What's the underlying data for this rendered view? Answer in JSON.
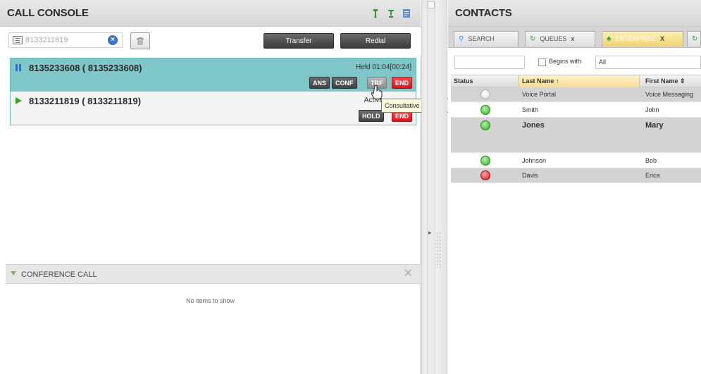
{
  "call_console": {
    "title": "CALL CONSOLE",
    "header_icons": [
      "phone-up-icon",
      "phone-settings-icon",
      "notes-icon"
    ],
    "dial_input": {
      "value": "8133211819"
    },
    "buttons": {
      "transfer": "Transfer",
      "redial": "Redial"
    },
    "calls": [
      {
        "number": "8135233608 ( 8135233608)",
        "status": "Held 01:04[00:24]",
        "state": "held",
        "actions": [
          "ANS",
          "CONF",
          "TRF",
          "END"
        ]
      },
      {
        "number": "8133211819 ( 8133211819)",
        "status": "Active",
        "state": "active",
        "actions": [
          "HOLD",
          "END"
        ]
      }
    ],
    "tooltip": "Consultative Transfer",
    "conference": {
      "title": "CONFERENCE CALL",
      "empty_text": "No items to show"
    }
  },
  "contacts": {
    "title": "CONTACTS",
    "tabs": [
      {
        "label": "SEARCH",
        "icon": "search-icon",
        "closable": false
      },
      {
        "label": "QUEUES",
        "icon": "queue-icon",
        "closable": true
      },
      {
        "label": "ENTERPRISE",
        "icon": "enterprise-icon",
        "closable": true
      }
    ],
    "search": {
      "value": "",
      "begins_with_label": "Begins with",
      "filter_value": "All"
    },
    "columns": {
      "status": "Status",
      "last": "Last Name",
      "first": "First Name"
    },
    "rows": [
      {
        "status": "offline",
        "last": "Voice Portal",
        "first": "Voice Messaging"
      },
      {
        "status": "available",
        "last": "Smith",
        "first": "John"
      },
      {
        "status": "available",
        "last": "Jones",
        "first": "Mary",
        "selected": true
      },
      {
        "status": "available",
        "last": "Johnson",
        "first": "Bob"
      },
      {
        "status": "busy",
        "last": "Davis",
        "first": "Erica"
      }
    ]
  },
  "colors": {
    "held_call_bg": "#7fc6c8",
    "end_button": "#e01820",
    "available": "#30b22a",
    "busy": "#d91515"
  }
}
